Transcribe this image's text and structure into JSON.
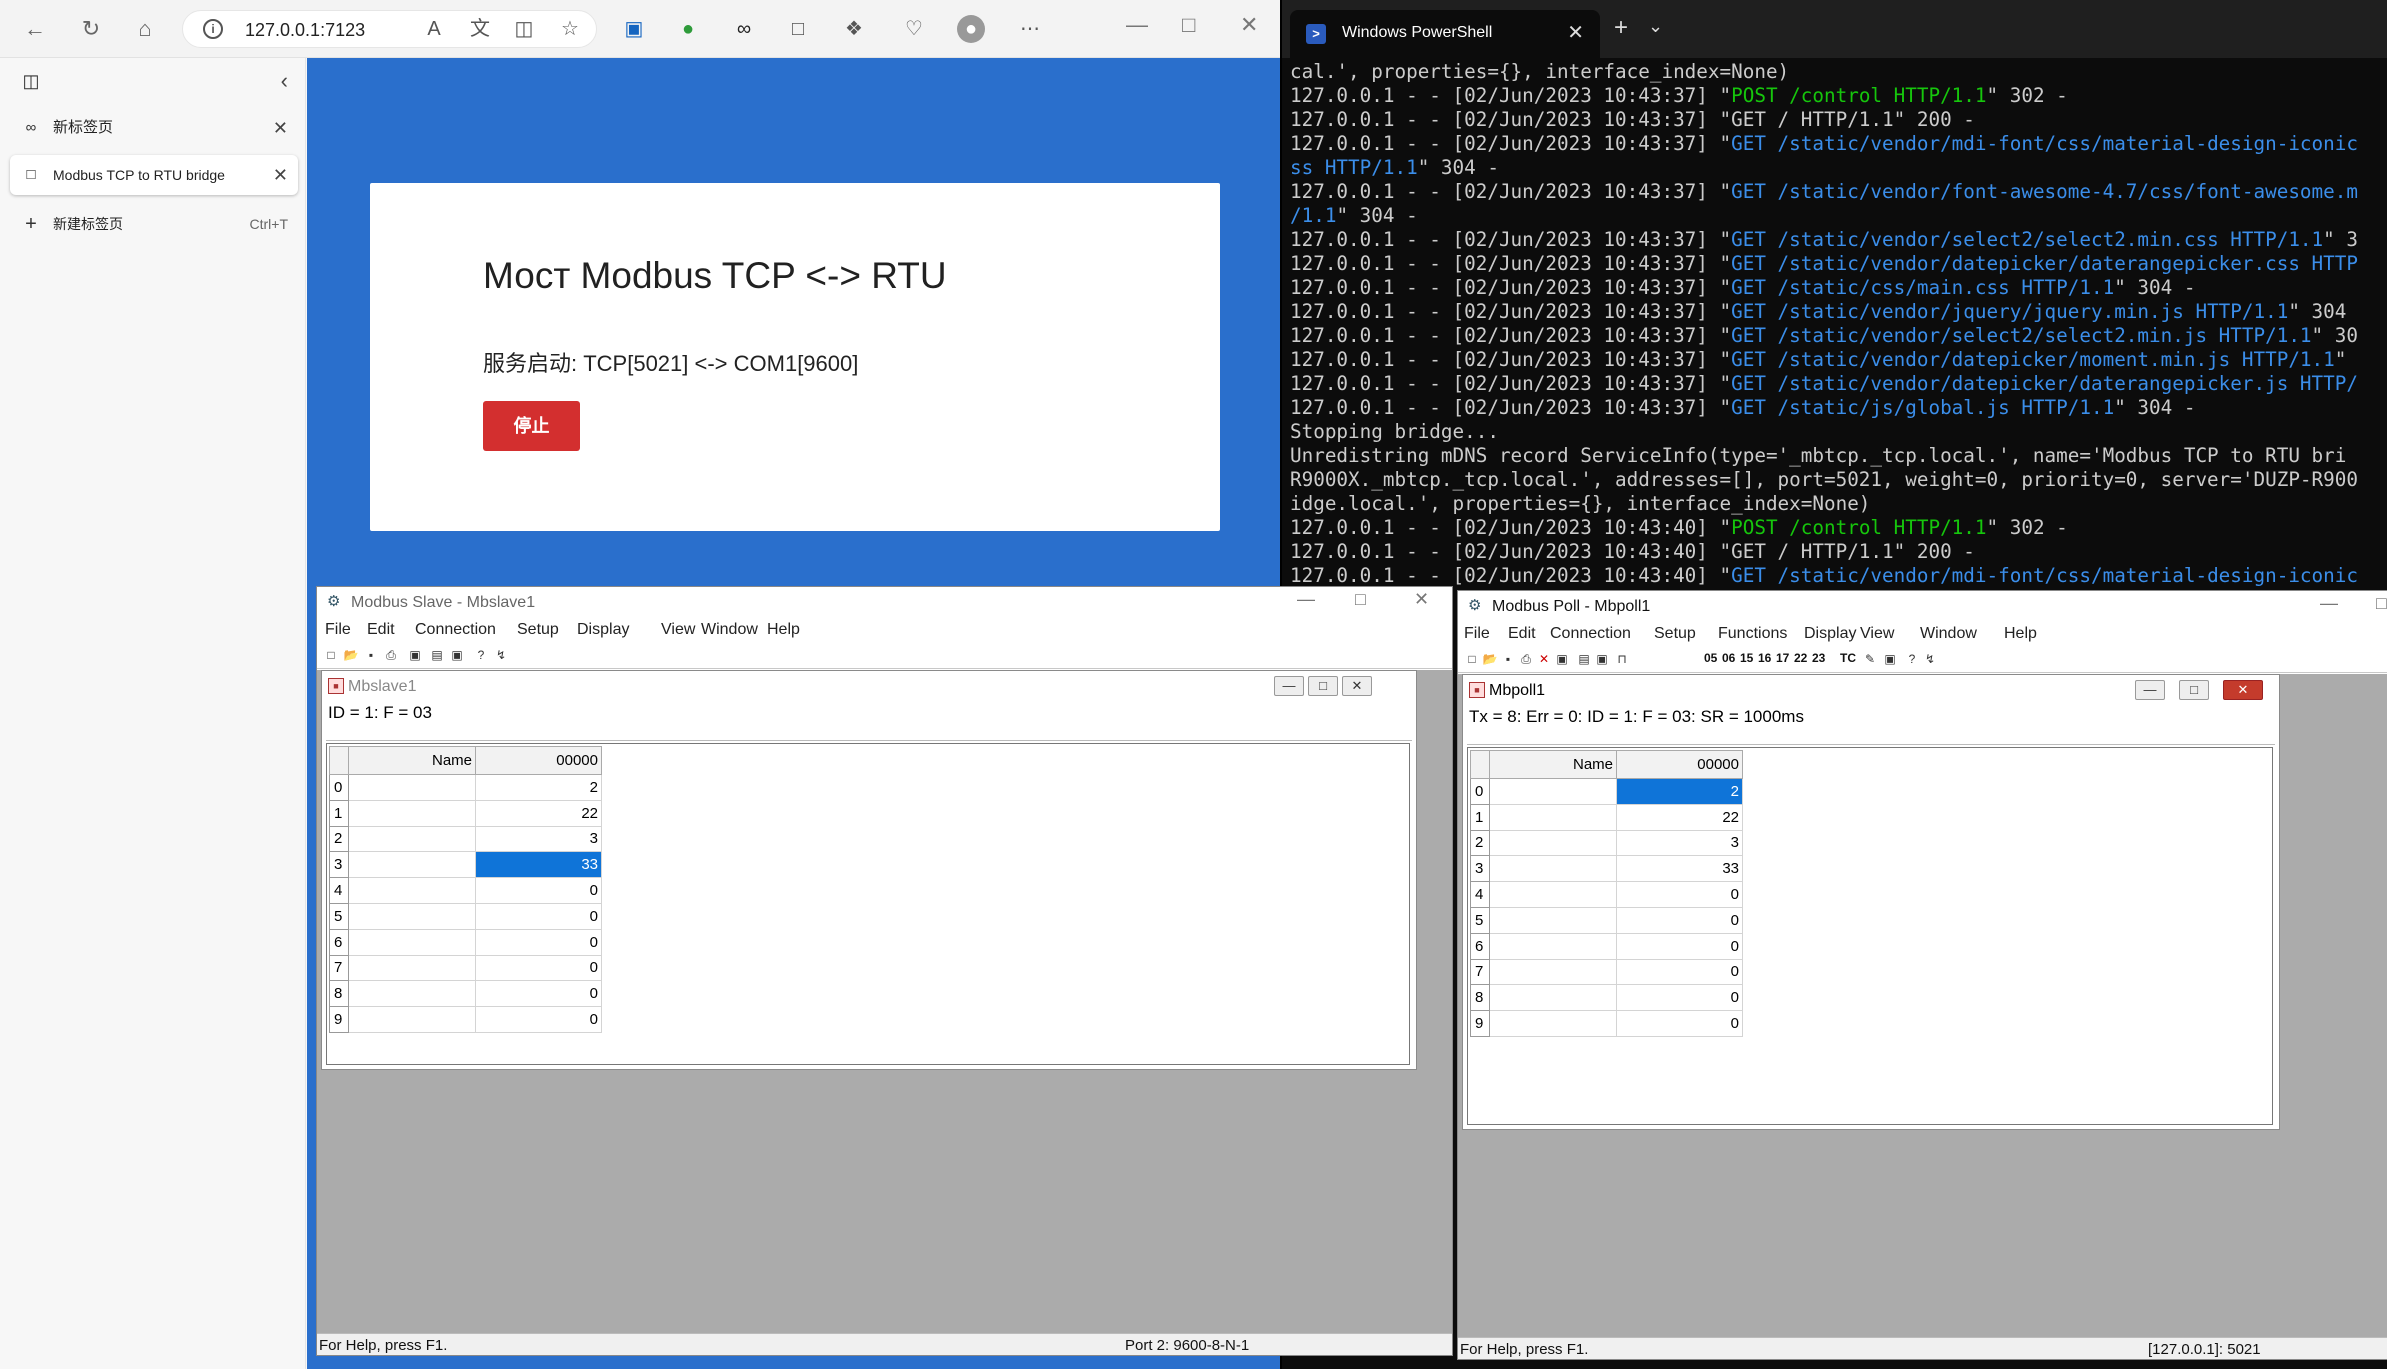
{
  "browser": {
    "url": "127.0.0.1:7123",
    "sidebar": {
      "items": [
        {
          "label": "新标签页"
        },
        {
          "label": "Modbus TCP to RTU bridge"
        },
        {
          "label": "新建标签页",
          "shortcut": "Ctrl+T"
        }
      ]
    },
    "page": {
      "title": "Мост Modbus TCP <-> RTU",
      "status": "服务启动: TCP[5021] <-> COM1[9600]",
      "stop_button": "停止"
    }
  },
  "powershell": {
    "tab_title": "Windows PowerShell",
    "lines": [
      [
        {
          "t": "cal.', properties={}, interface_index=None)"
        }
      ],
      [
        {
          "t": "127.0.0.1 - - [02/Jun/2023 10:43:37] \""
        },
        {
          "t": "POST /control HTTP/1.1",
          "c": "g"
        },
        {
          "t": "\" 302 -"
        }
      ],
      [
        {
          "t": "127.0.0.1 - - [02/Jun/2023 10:43:37] \"GET / HTTP/1.1\" 200 -"
        }
      ],
      [
        {
          "t": "127.0.0.1 - - [02/Jun/2023 10:43:37] \""
        },
        {
          "t": "GET /static/vendor/mdi-font/css/material-design-iconic",
          "c": "b"
        }
      ],
      [
        {
          "t": "ss HTTP/1.1",
          "c": "b"
        },
        {
          "t": "\" 304 -"
        }
      ],
      [
        {
          "t": "127.0.0.1 - - [02/Jun/2023 10:43:37] \""
        },
        {
          "t": "GET /static/vendor/font-awesome-4.7/css/font-awesome.m",
          "c": "b"
        }
      ],
      [
        {
          "t": "/1.1",
          "c": "b"
        },
        {
          "t": "\" 304 -"
        }
      ],
      [
        {
          "t": "127.0.0.1 - - [02/Jun/2023 10:43:37] \""
        },
        {
          "t": "GET /static/vendor/select2/select2.min.css HTTP/1.1",
          "c": "b"
        },
        {
          "t": "\" 3"
        }
      ],
      [
        {
          "t": "127.0.0.1 - - [02/Jun/2023 10:43:37] \""
        },
        {
          "t": "GET /static/vendor/datepicker/daterangepicker.css HTTP",
          "c": "b"
        }
      ],
      [
        {
          "t": "127.0.0.1 - - [02/Jun/2023 10:43:37] \""
        },
        {
          "t": "GET /static/css/main.css HTTP/1.1",
          "c": "b"
        },
        {
          "t": "\" 304 -"
        }
      ],
      [
        {
          "t": "127.0.0.1 - - [02/Jun/2023 10:43:37] \""
        },
        {
          "t": "GET /static/vendor/jquery/jquery.min.js HTTP/1.1",
          "c": "b"
        },
        {
          "t": "\" 304"
        }
      ],
      [
        {
          "t": "127.0.0.1 - - [02/Jun/2023 10:43:37] \""
        },
        {
          "t": "GET /static/vendor/select2/select2.min.js HTTP/1.1",
          "c": "b"
        },
        {
          "t": "\" 30"
        }
      ],
      [
        {
          "t": "127.0.0.1 - - [02/Jun/2023 10:43:37] \""
        },
        {
          "t": "GET /static/vendor/datepicker/moment.min.js HTTP/1.1",
          "c": "b"
        },
        {
          "t": "\""
        }
      ],
      [
        {
          "t": "127.0.0.1 - - [02/Jun/2023 10:43:37] \""
        },
        {
          "t": "GET /static/vendor/datepicker/daterangepicker.js HTTP/",
          "c": "b"
        }
      ],
      [
        {
          "t": "127.0.0.1 - - [02/Jun/2023 10:43:37] \""
        },
        {
          "t": "GET /static/js/global.js HTTP/1.1",
          "c": "b"
        },
        {
          "t": "\" 304 -"
        }
      ],
      [
        {
          "t": "Stopping bridge..."
        }
      ],
      [
        {
          "t": "Unredistring mDNS record ServiceInfo(type='_mbtcp._tcp.local.', name='Modbus TCP to RTU bri"
        }
      ],
      [
        {
          "t": "R9000X._mbtcp._tcp.local.', addresses=[], port=5021, weight=0, priority=0, server='DUZP-R900"
        }
      ],
      [
        {
          "t": "idge.local.', properties={}, interface_index=None)"
        }
      ],
      [
        {
          "t": "127.0.0.1 - - [02/Jun/2023 10:43:40] \""
        },
        {
          "t": "POST /control HTTP/1.1",
          "c": "g"
        },
        {
          "t": "\" 302 -"
        }
      ],
      [
        {
          "t": "127.0.0.1 - - [02/Jun/2023 10:43:40] \"GET / HTTP/1.1\" 200 -"
        }
      ],
      [
        {
          "t": "127.0.0.1 - - [02/Jun/2023 10:43:40] \""
        },
        {
          "t": "GET /static/vendor/mdi-font/css/material-design-iconic",
          "c": "b"
        }
      ]
    ]
  },
  "mbslave": {
    "title": "Modbus Slave - Mbslave1",
    "menu": [
      "File",
      "Edit",
      "Connection",
      "Setup",
      "Display",
      "View",
      "Window",
      "Help"
    ],
    "child_title": "Mbslave1",
    "info": "ID = 1: F = 03",
    "col_name": "Name",
    "col_addr": "00000",
    "rows": [
      "0",
      "1",
      "2",
      "3",
      "4",
      "5",
      "6",
      "7",
      "8",
      "9"
    ],
    "values": [
      "2",
      "22",
      "3",
      "33",
      "0",
      "0",
      "0",
      "0",
      "0",
      "0"
    ],
    "selected_row": 3,
    "status_left": "For Help, press F1.",
    "status_right": "Port 2: 9600-8-N-1"
  },
  "mbpoll": {
    "title": "Modbus Poll - Mbpoll1",
    "menu": [
      "File",
      "Edit",
      "Connection",
      "Setup",
      "Functions",
      "Display",
      "View",
      "Window",
      "Help"
    ],
    "toolbar_codes": [
      "05",
      "06",
      "15",
      "16",
      "17",
      "22",
      "23",
      "TC"
    ],
    "child_title": "Mbpoll1",
    "info": "Tx = 8: Err = 0: ID = 1: F = 03: SR = 1000ms",
    "col_name": "Name",
    "col_addr": "00000",
    "rows": [
      "0",
      "1",
      "2",
      "3",
      "4",
      "5",
      "6",
      "7",
      "8",
      "9"
    ],
    "values": [
      "2",
      "22",
      "3",
      "33",
      "0",
      "0",
      "0",
      "0",
      "0",
      "0"
    ],
    "selected_row": 0,
    "status_left": "For Help, press F1.",
    "status_right": "[127.0.0.1]: 5021"
  }
}
